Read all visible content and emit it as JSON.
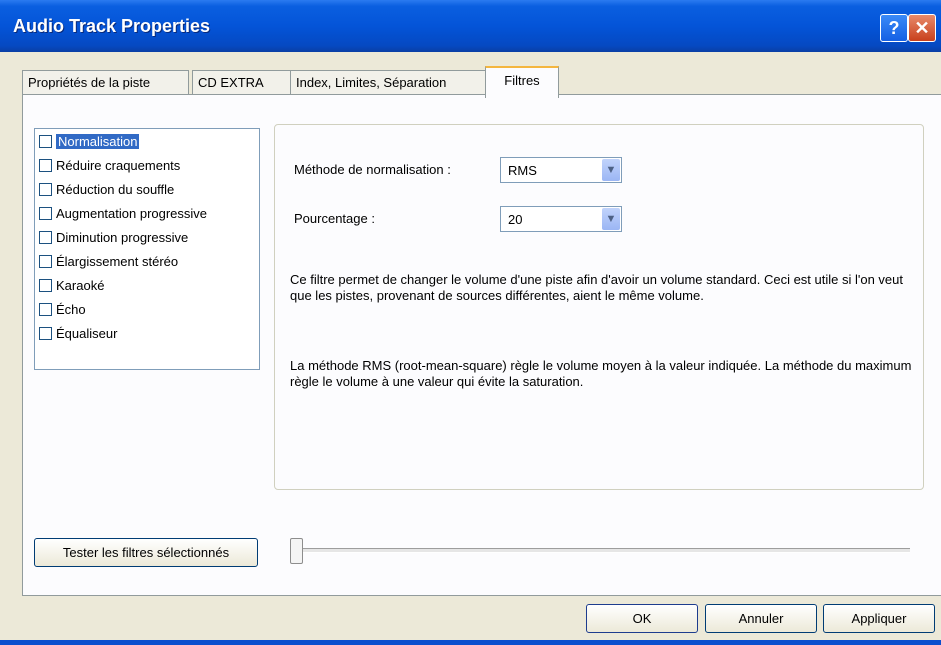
{
  "window": {
    "title": "Audio Track Properties",
    "help_icon": "help-icon",
    "close_icon": "close-icon",
    "help_glyph": "?",
    "close_glyph": "✕"
  },
  "tabs": [
    {
      "label": "Propriétés de la piste",
      "active": false
    },
    {
      "label": "CD EXTRA",
      "active": false
    },
    {
      "label": "Index, Limites, Séparation",
      "active": false
    },
    {
      "label": "Filtres",
      "active": true
    }
  ],
  "filters": {
    "selected": "Normalisation",
    "items": [
      {
        "label": "Normalisation",
        "checked": false
      },
      {
        "label": "Réduire craquements",
        "checked": false
      },
      {
        "label": "Réduction du souffle",
        "checked": false
      },
      {
        "label": "Augmentation progressive",
        "checked": false
      },
      {
        "label": "Diminution progressive",
        "checked": false
      },
      {
        "label": "Élargissement stéréo",
        "checked": false
      },
      {
        "label": "Karaoké",
        "checked": false
      },
      {
        "label": "Écho",
        "checked": false
      },
      {
        "label": "Équaliseur",
        "checked": false
      }
    ]
  },
  "settings": {
    "method_label": "Méthode de normalisation :",
    "method_value": "RMS",
    "percent_label": "Pourcentage :",
    "percent_value": "20",
    "dropdown_icon": "chevron-down-icon",
    "dropdown_glyph": "▼",
    "description_1": "Ce filtre permet de changer le volume d'une piste afin d'avoir un volume standard. Ceci est utile si l'on veut que les pistes, provenant de sources différentes, aient le même volume.",
    "description_2": "La méthode RMS (root-mean-square) règle le volume moyen à la valeur indiquée. La méthode du maximum règle le volume à une valeur qui évite la saturation."
  },
  "test": {
    "button_label": "Tester les filtres sélectionnés",
    "slider_value": 0
  },
  "footer": {
    "ok_label": "OK",
    "cancel_label": "Annuler",
    "apply_label": "Appliquer"
  },
  "colors": {
    "titlebar": "#0454d8",
    "selection": "#316ac5",
    "dialog_bg": "#ece9d8",
    "tab_highlight": "#f4b63f"
  }
}
